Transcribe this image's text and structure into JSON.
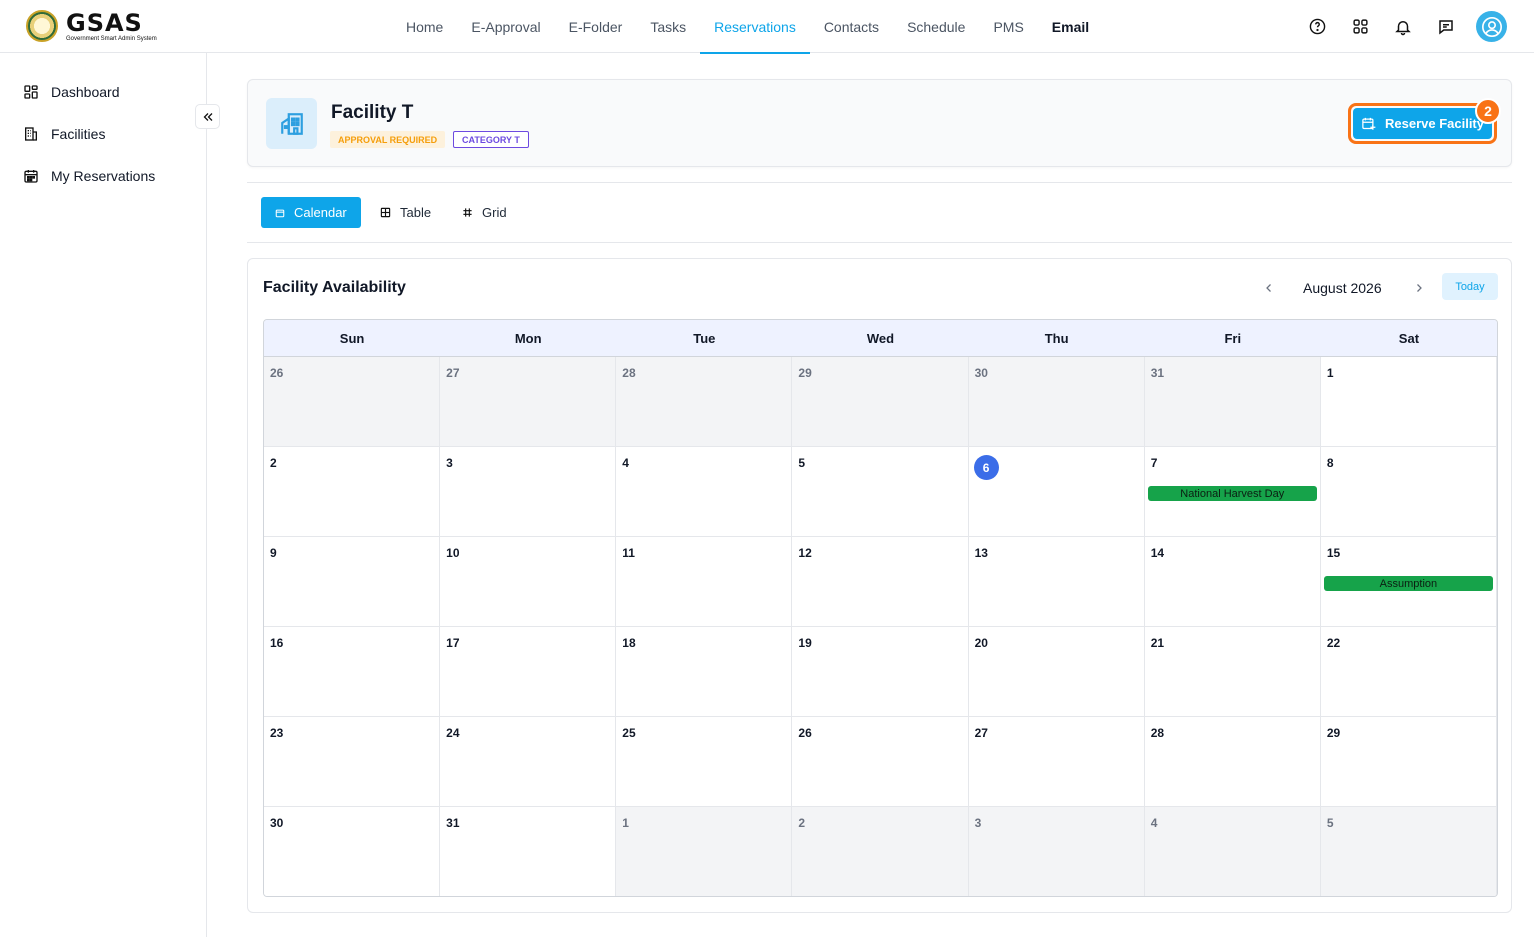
{
  "brand": {
    "title": "GSAS",
    "subtitle": "Government Smart Admin System"
  },
  "nav": [
    "Home",
    "E-Approval",
    "E-Folder",
    "Tasks",
    "Reservations",
    "Contacts",
    "Schedule",
    "PMS",
    "Email"
  ],
  "nav_active": "Reservations",
  "sidebar": {
    "items": [
      "Dashboard",
      "Facilities",
      "My Reservations"
    ]
  },
  "facility": {
    "name": "Facility T",
    "badges": {
      "approval": "APPROVAL REQUIRED",
      "category": "CATEGORY T"
    },
    "reserve_label": "Reserve Facility",
    "counter": "2"
  },
  "views": {
    "calendar": "Calendar",
    "table": "Table",
    "grid": "Grid"
  },
  "availability": {
    "title": "Facility Availability",
    "month": "August 2026",
    "today_label": "Today",
    "weekdays": [
      "Sun",
      "Mon",
      "Tue",
      "Wed",
      "Thu",
      "Fri",
      "Sat"
    ],
    "weeks": [
      [
        {
          "d": "26",
          "m": true
        },
        {
          "d": "27",
          "m": true
        },
        {
          "d": "28",
          "m": true
        },
        {
          "d": "29",
          "m": true
        },
        {
          "d": "30",
          "m": true
        },
        {
          "d": "31",
          "m": true
        },
        {
          "d": "1"
        }
      ],
      [
        {
          "d": "2"
        },
        {
          "d": "3"
        },
        {
          "d": "4"
        },
        {
          "d": "5"
        },
        {
          "d": "6",
          "today": true
        },
        {
          "d": "7",
          "event": "National Harvest Day"
        },
        {
          "d": "8"
        }
      ],
      [
        {
          "d": "9"
        },
        {
          "d": "10"
        },
        {
          "d": "11"
        },
        {
          "d": "12"
        },
        {
          "d": "13"
        },
        {
          "d": "14"
        },
        {
          "d": "15",
          "event": "Assumption"
        }
      ],
      [
        {
          "d": "16"
        },
        {
          "d": "17"
        },
        {
          "d": "18"
        },
        {
          "d": "19"
        },
        {
          "d": "20"
        },
        {
          "d": "21"
        },
        {
          "d": "22"
        }
      ],
      [
        {
          "d": "23"
        },
        {
          "d": "24"
        },
        {
          "d": "25"
        },
        {
          "d": "26"
        },
        {
          "d": "27"
        },
        {
          "d": "28"
        },
        {
          "d": "29"
        }
      ],
      [
        {
          "d": "30"
        },
        {
          "d": "31"
        },
        {
          "d": "1",
          "m": true
        },
        {
          "d": "2",
          "m": true
        },
        {
          "d": "3",
          "m": true
        },
        {
          "d": "4",
          "m": true
        },
        {
          "d": "5",
          "m": true
        }
      ]
    ]
  },
  "colors": {
    "accent": "#0ea5e9",
    "highlight": "#f97316",
    "event": "#16a34a",
    "today": "#3b6de8"
  }
}
